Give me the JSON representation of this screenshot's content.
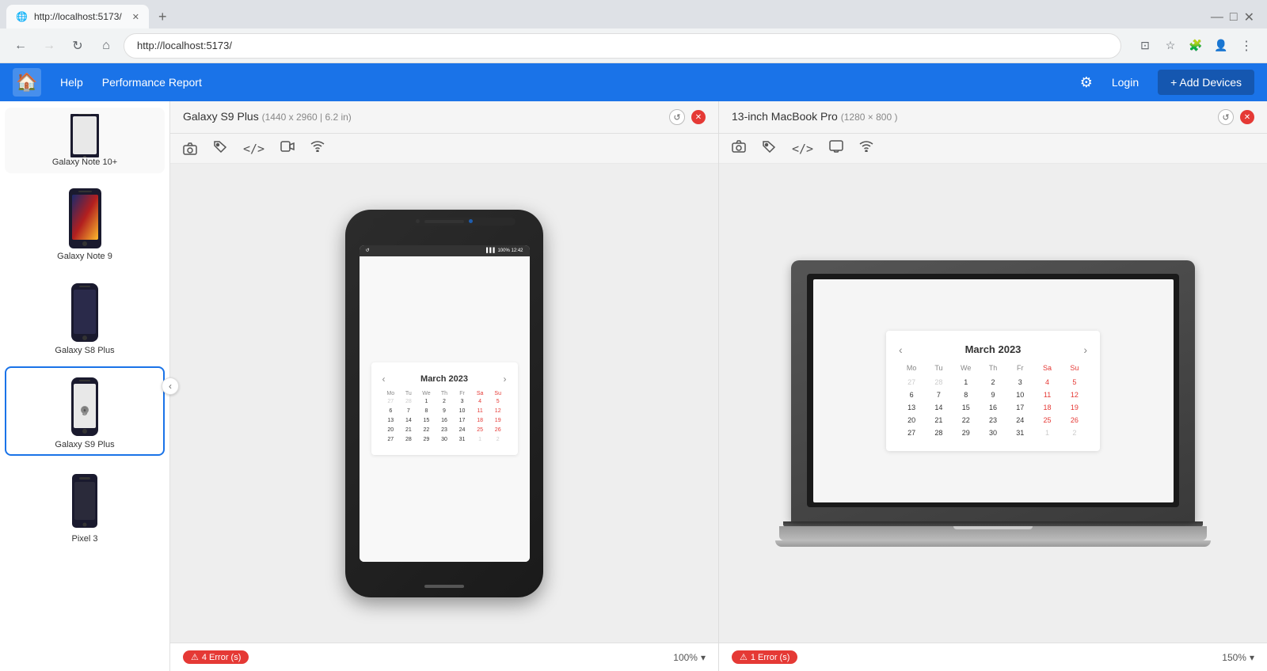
{
  "browser": {
    "tab_title": "http://localhost:5173/",
    "tab_favicon": "🌐",
    "url": "http://localhost:5173/",
    "nav_back": "←",
    "nav_forward": "→",
    "nav_refresh": "↻",
    "nav_home": "⌂"
  },
  "app": {
    "logo": "🏠",
    "nav_help": "Help",
    "nav_performance": "Performance Report",
    "header_settings": "⚙",
    "header_login": "Login",
    "header_add_devices": "+ Add Devices"
  },
  "sidebar": {
    "items": [
      {
        "name": "Galaxy Note 10+",
        "active": false
      },
      {
        "name": "Galaxy Note 9",
        "active": false
      },
      {
        "name": "Galaxy S8 Plus",
        "active": false
      },
      {
        "name": "Galaxy S9 Plus",
        "active": true
      },
      {
        "name": "Pixel 3",
        "active": false
      }
    ],
    "collapse_icon": "‹"
  },
  "panels": [
    {
      "id": "galaxy-s9-plus",
      "title": "Galaxy S9 Plus",
      "specs": "(1440 x 2960 | 6.2 in)",
      "zoom": "100%",
      "errors": "4 Error (s)",
      "toolbar": [
        "📷",
        "🏷️",
        "</>",
        "🎬",
        "📶"
      ],
      "calendar": {
        "month": "March 2023",
        "days_header": [
          "Mo",
          "Tu",
          "We",
          "Th",
          "Fr",
          "Sa",
          "Su"
        ],
        "weeks": [
          [
            "27",
            "28",
            "1",
            "2",
            "3",
            "4",
            "5"
          ],
          [
            "6",
            "7",
            "8",
            "9",
            "10",
            "11",
            "12"
          ],
          [
            "13",
            "14",
            "15",
            "16",
            "17",
            "18",
            "19"
          ],
          [
            "20",
            "21",
            "22",
            "23",
            "24",
            "25",
            "26"
          ],
          [
            "27",
            "28",
            "29",
            "30",
            "31",
            "1",
            "2"
          ]
        ],
        "weekends": [
          "4",
          "5",
          "11",
          "12",
          "18",
          "19",
          "25",
          "26",
          "1",
          "2"
        ],
        "other_month": [
          "27",
          "28",
          "1",
          "2"
        ]
      }
    },
    {
      "id": "macbook-pro",
      "title": "13-inch MacBook Pro",
      "specs": "(1280 × 800 )",
      "zoom": "150%",
      "errors": "1 Error (s)",
      "toolbar": [
        "📷",
        "🏷️",
        "</>",
        "🖥️",
        "📶"
      ],
      "calendar": {
        "month": "March 2023",
        "days_header": [
          "Mo",
          "Tu",
          "We",
          "Th",
          "Fr",
          "Sa",
          "Su"
        ],
        "weeks": [
          [
            "27",
            "28",
            "1",
            "2",
            "3",
            "4",
            "5"
          ],
          [
            "6",
            "7",
            "8",
            "9",
            "10",
            "11",
            "12"
          ],
          [
            "13",
            "14",
            "15",
            "16",
            "17",
            "18",
            "19"
          ],
          [
            "20",
            "21",
            "22",
            "23",
            "24",
            "25",
            "26"
          ],
          [
            "27",
            "28",
            "29",
            "30",
            "31",
            "1",
            "2"
          ]
        ],
        "weekends": [
          "4",
          "5",
          "11",
          "12",
          "18",
          "19",
          "25",
          "26",
          "1",
          "2"
        ],
        "other_month": [
          "27",
          "28",
          "1",
          "2"
        ]
      }
    }
  ],
  "colors": {
    "primary": "#1a73e8",
    "error": "#e53935",
    "weekend": "#e53935"
  }
}
